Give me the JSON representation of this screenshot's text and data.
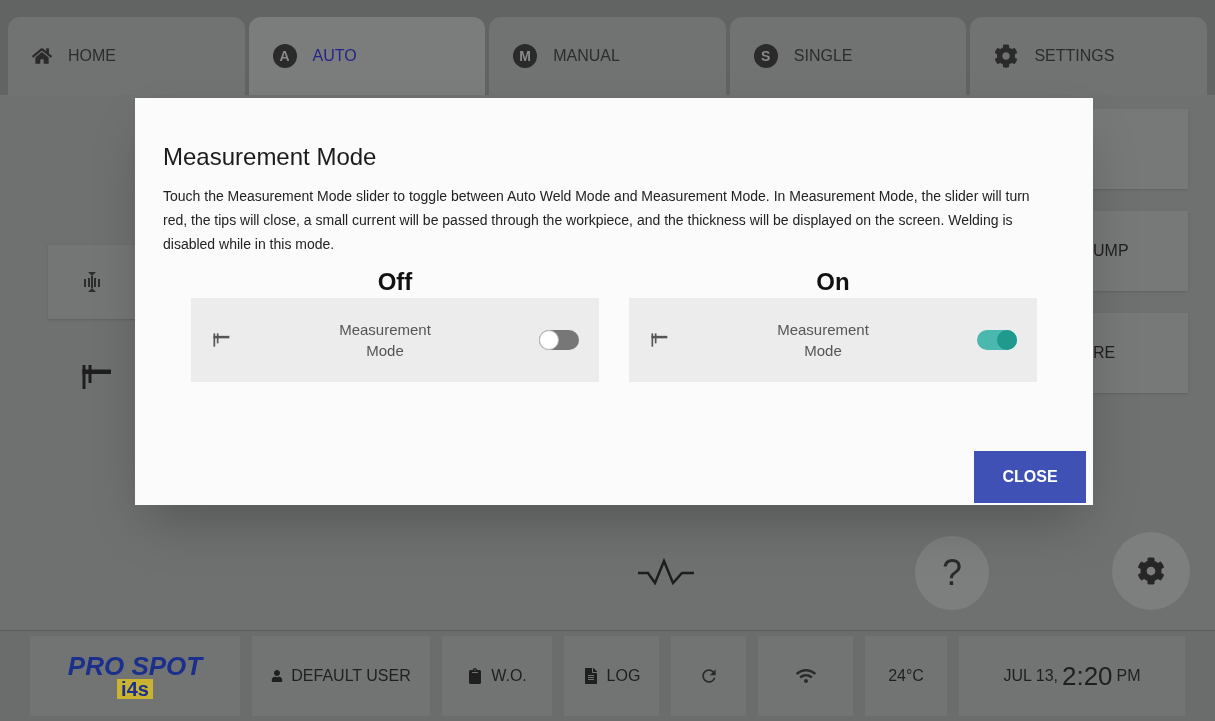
{
  "tabs": [
    {
      "kind": "home",
      "label": "HOME",
      "selected": false
    },
    {
      "kind": "letter",
      "badge": "A",
      "label": "AUTO",
      "selected": true
    },
    {
      "kind": "letter",
      "badge": "M",
      "label": "MANUAL",
      "selected": false
    },
    {
      "kind": "letter",
      "badge": "S",
      "label": "SINGLE",
      "selected": false
    },
    {
      "kind": "settings",
      "label": "SETTINGS",
      "selected": false
    }
  ],
  "right_buttons": [
    {
      "kind": "blank"
    },
    {
      "kind": "text",
      "label": "UMP"
    },
    {
      "kind": "text",
      "label": "RE"
    }
  ],
  "help_button": {
    "label": "?"
  },
  "dialog": {
    "title": "Measurement Mode",
    "body": "Touch the Measurement Mode slider to toggle between Auto Weld Mode and Measurement Mode. In Measurement Mode, the slider will turn red, the tips will close, a small current will be passed through the workpiece, and the thickness will be displayed on the screen. Welding is disabled while in this mode.",
    "examples": [
      {
        "heading": "Off",
        "label": "Measurement Mode",
        "on": false
      },
      {
        "heading": "On",
        "label": "Measurement Mode",
        "on": true
      }
    ],
    "close_button": "CLOSE"
  },
  "status_bar": {
    "logo": "PRO SPOT",
    "logo_sub": "i4s",
    "user": "DEFAULT USER",
    "work_order": "W.O.",
    "log": "LOG",
    "temperature": "24°C",
    "date": "JUL 13,",
    "time": "2:20",
    "meridiem": "PM"
  }
}
